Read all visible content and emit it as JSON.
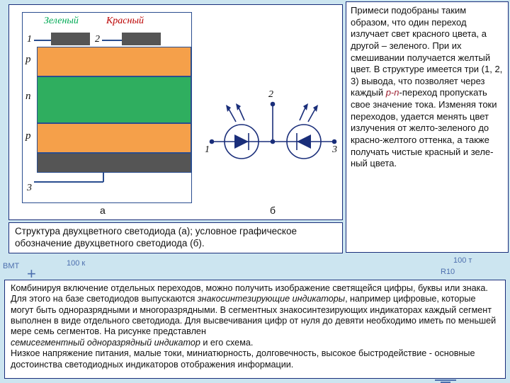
{
  "bg": {
    "bmt": "ВМТ",
    "r_left": "100 к",
    "r_right": "100 т",
    "rlabel": "R10",
    "plus": "+"
  },
  "diagram": {
    "green": "Зеленый",
    "red": "Красный",
    "leads": {
      "one": "1",
      "two": "2",
      "three": "3"
    },
    "p": "p",
    "n": "n",
    "sub_a": "а",
    "sub_b": "б",
    "sym": {
      "one": "1",
      "two": "2",
      "three": "3"
    }
  },
  "caption": "Структура двухцветного светодиода (а); условное графическое обозначение двухцветного светодиода (б).",
  "right_text": {
    "part1": "Примеси подобраны таким образом, что один переход излучает свет красного цве­та, а другой – зеленого. При их смешивании получается желтый цвет. В структуре имеется три (1, 2, 3) вывода, что позволяет через каждый ",
    "pn": "p-n",
    "part2": "-переход пропускать свое значение тока. Изменяя токи переходов, удается ме­нять цвет излучения от жел­то-зеленого до красно-жел­того оттенка, а также полу­чать чистые красный и зеле­ный цвета."
  },
  "bottom_text": {
    "l1a": "Комбинируя включение отдельных переходов, можно получить изображение светящейся цифры, бук­вы или знака. Для этого на базе светодиодов выпускаются ",
    "l1b": "знакосинтезирующие индикаторы",
    "l1c": ", напри­мер цифровые, которые могут быть одноразрядными и многоразрядными. В сегментных знакосинте­зирующих индикаторах каждый сегмент выполнен в виде отдельного светодиода. Для высвечивания цифр от нуля до девяти необходимо иметь по меньшей мере семь сегментов. На рисунке представлен ",
    "l2a": "семисегментный одноразрядный индикатор",
    "l2b": " и его схема.",
    "l3": "Низкое напряжение питания, малые токи, миниатюрность, долговечность, высокое быстродействие - основные достоинства светодиодных индикаторов отображения информации."
  }
}
